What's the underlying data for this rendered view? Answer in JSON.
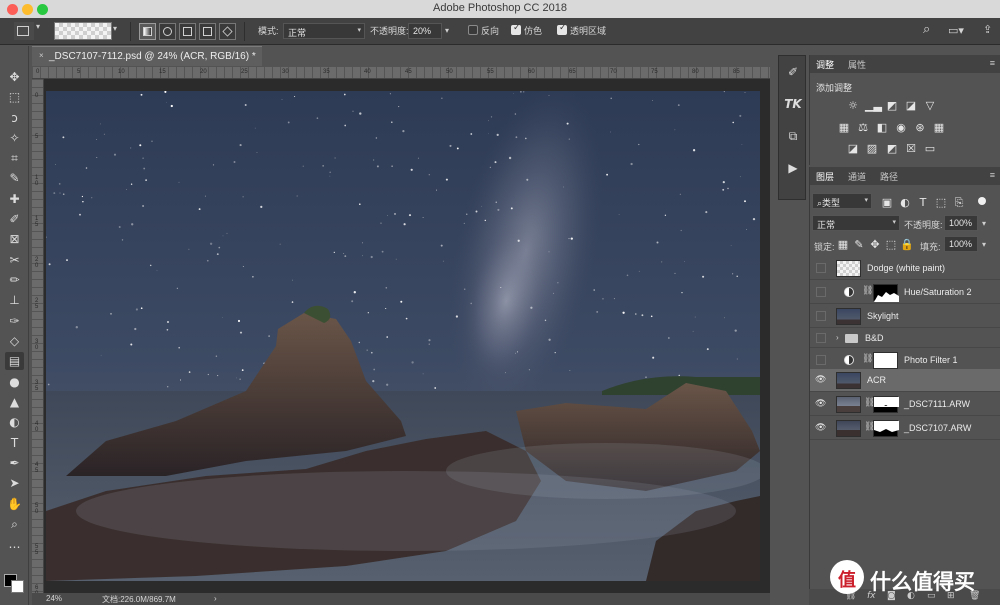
{
  "window": {
    "title": "Adobe Photoshop CC 2018"
  },
  "options": {
    "mode_label": "模式:",
    "mode_value": "正常",
    "opacity_label": "不透明度:",
    "opacity_value": "20%",
    "reverse_label": "反向",
    "reverse_checked": false,
    "dither_label": "仿色",
    "dither_checked": true,
    "transparency_label": "透明区域",
    "transparency_checked": true
  },
  "document": {
    "tab_title": "_DSC7107-7112.psd @ 24% (ACR, RGB/16) *",
    "zoom": "24%",
    "doc_size": "文档:226.0M/869.7M",
    "ruler_h": [
      "0",
      "5",
      "10",
      "15",
      "20",
      "25",
      "30",
      "35",
      "40",
      "45",
      "50",
      "55",
      "60",
      "65",
      "70",
      "75",
      "80",
      "85"
    ],
    "ruler_v": [
      "0",
      "5",
      "1 0",
      "1 5",
      "2 0",
      "2 5",
      "3 0",
      "3 5",
      "4 0",
      "4 5",
      "5 0",
      "5 5",
      "6 0"
    ]
  },
  "adjustments": {
    "tabs": [
      "调整",
      "属性"
    ],
    "add_label": "添加调整"
  },
  "layers_panel": {
    "tabs": [
      "图层",
      "通道",
      "路径"
    ],
    "filter_label": "类型",
    "blend_mode": "正常",
    "opacity_label": "不透明度:",
    "opacity_value": "100%",
    "lock_label": "锁定:",
    "fill_label": "填充:",
    "fill_value": "100%",
    "layers": [
      {
        "name": "Dodge (white paint)",
        "visible": false,
        "type": "pixel"
      },
      {
        "name": "Hue/Saturation 2",
        "visible": false,
        "type": "adjustment"
      },
      {
        "name": "Skylight",
        "visible": false,
        "type": "pixel"
      },
      {
        "name": "B&D",
        "visible": false,
        "type": "group"
      },
      {
        "name": "Photo Filter 1",
        "visible": false,
        "type": "adjustment"
      },
      {
        "name": "ACR",
        "visible": true,
        "type": "pixel",
        "selected": true
      },
      {
        "name": "_DSC7111.ARW",
        "visible": true,
        "type": "masked"
      },
      {
        "name": "_DSC7107.ARW",
        "visible": true,
        "type": "masked"
      }
    ]
  },
  "watermark": {
    "glyph": "值",
    "text": "什么值得买"
  },
  "colors": {
    "accent": "#535353",
    "sky": "#3a4a66"
  }
}
